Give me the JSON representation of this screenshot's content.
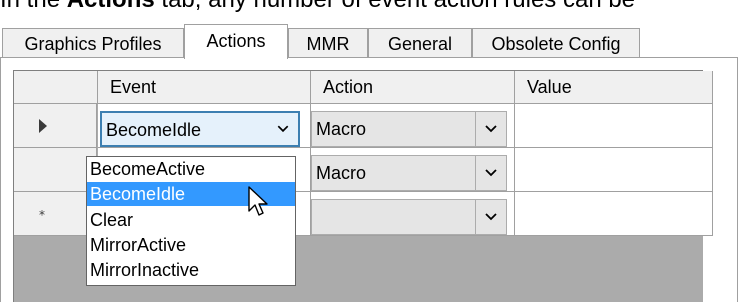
{
  "caption": {
    "prefix": "In the ",
    "bold": "Actions",
    "suffix": " tab, any number of event action rules can be"
  },
  "tabs": [
    {
      "label": "Graphics Profiles"
    },
    {
      "label": "Actions"
    },
    {
      "label": "MMR"
    },
    {
      "label": "General"
    },
    {
      "label": "Obsolete Config"
    }
  ],
  "grid": {
    "columns": [
      "Event",
      "Action",
      "Value"
    ],
    "rows": [
      {
        "event": "BecomeIdle",
        "action": "Macro",
        "value": ""
      },
      {
        "event": "",
        "action": "Macro",
        "value": ""
      },
      {
        "event": "",
        "action": "",
        "value": ""
      }
    ],
    "row_markers": [
      "►",
      "",
      "*"
    ]
  },
  "dropdown": {
    "options": [
      "BecomeActive",
      "BecomeIdle",
      "Clear",
      "MirrorActive",
      "MirrorInactive"
    ],
    "selected": "BecomeIdle"
  },
  "colors": {
    "selection": "#3399ff",
    "focus_border": "#3c7fb1",
    "grid_background": "#ababab"
  },
  "icons": {
    "dropdown": "chevron-down-icon",
    "current_row": "row-pointer-icon",
    "new_row": "new-row-icon",
    "cursor": "mouse-pointer-icon"
  }
}
